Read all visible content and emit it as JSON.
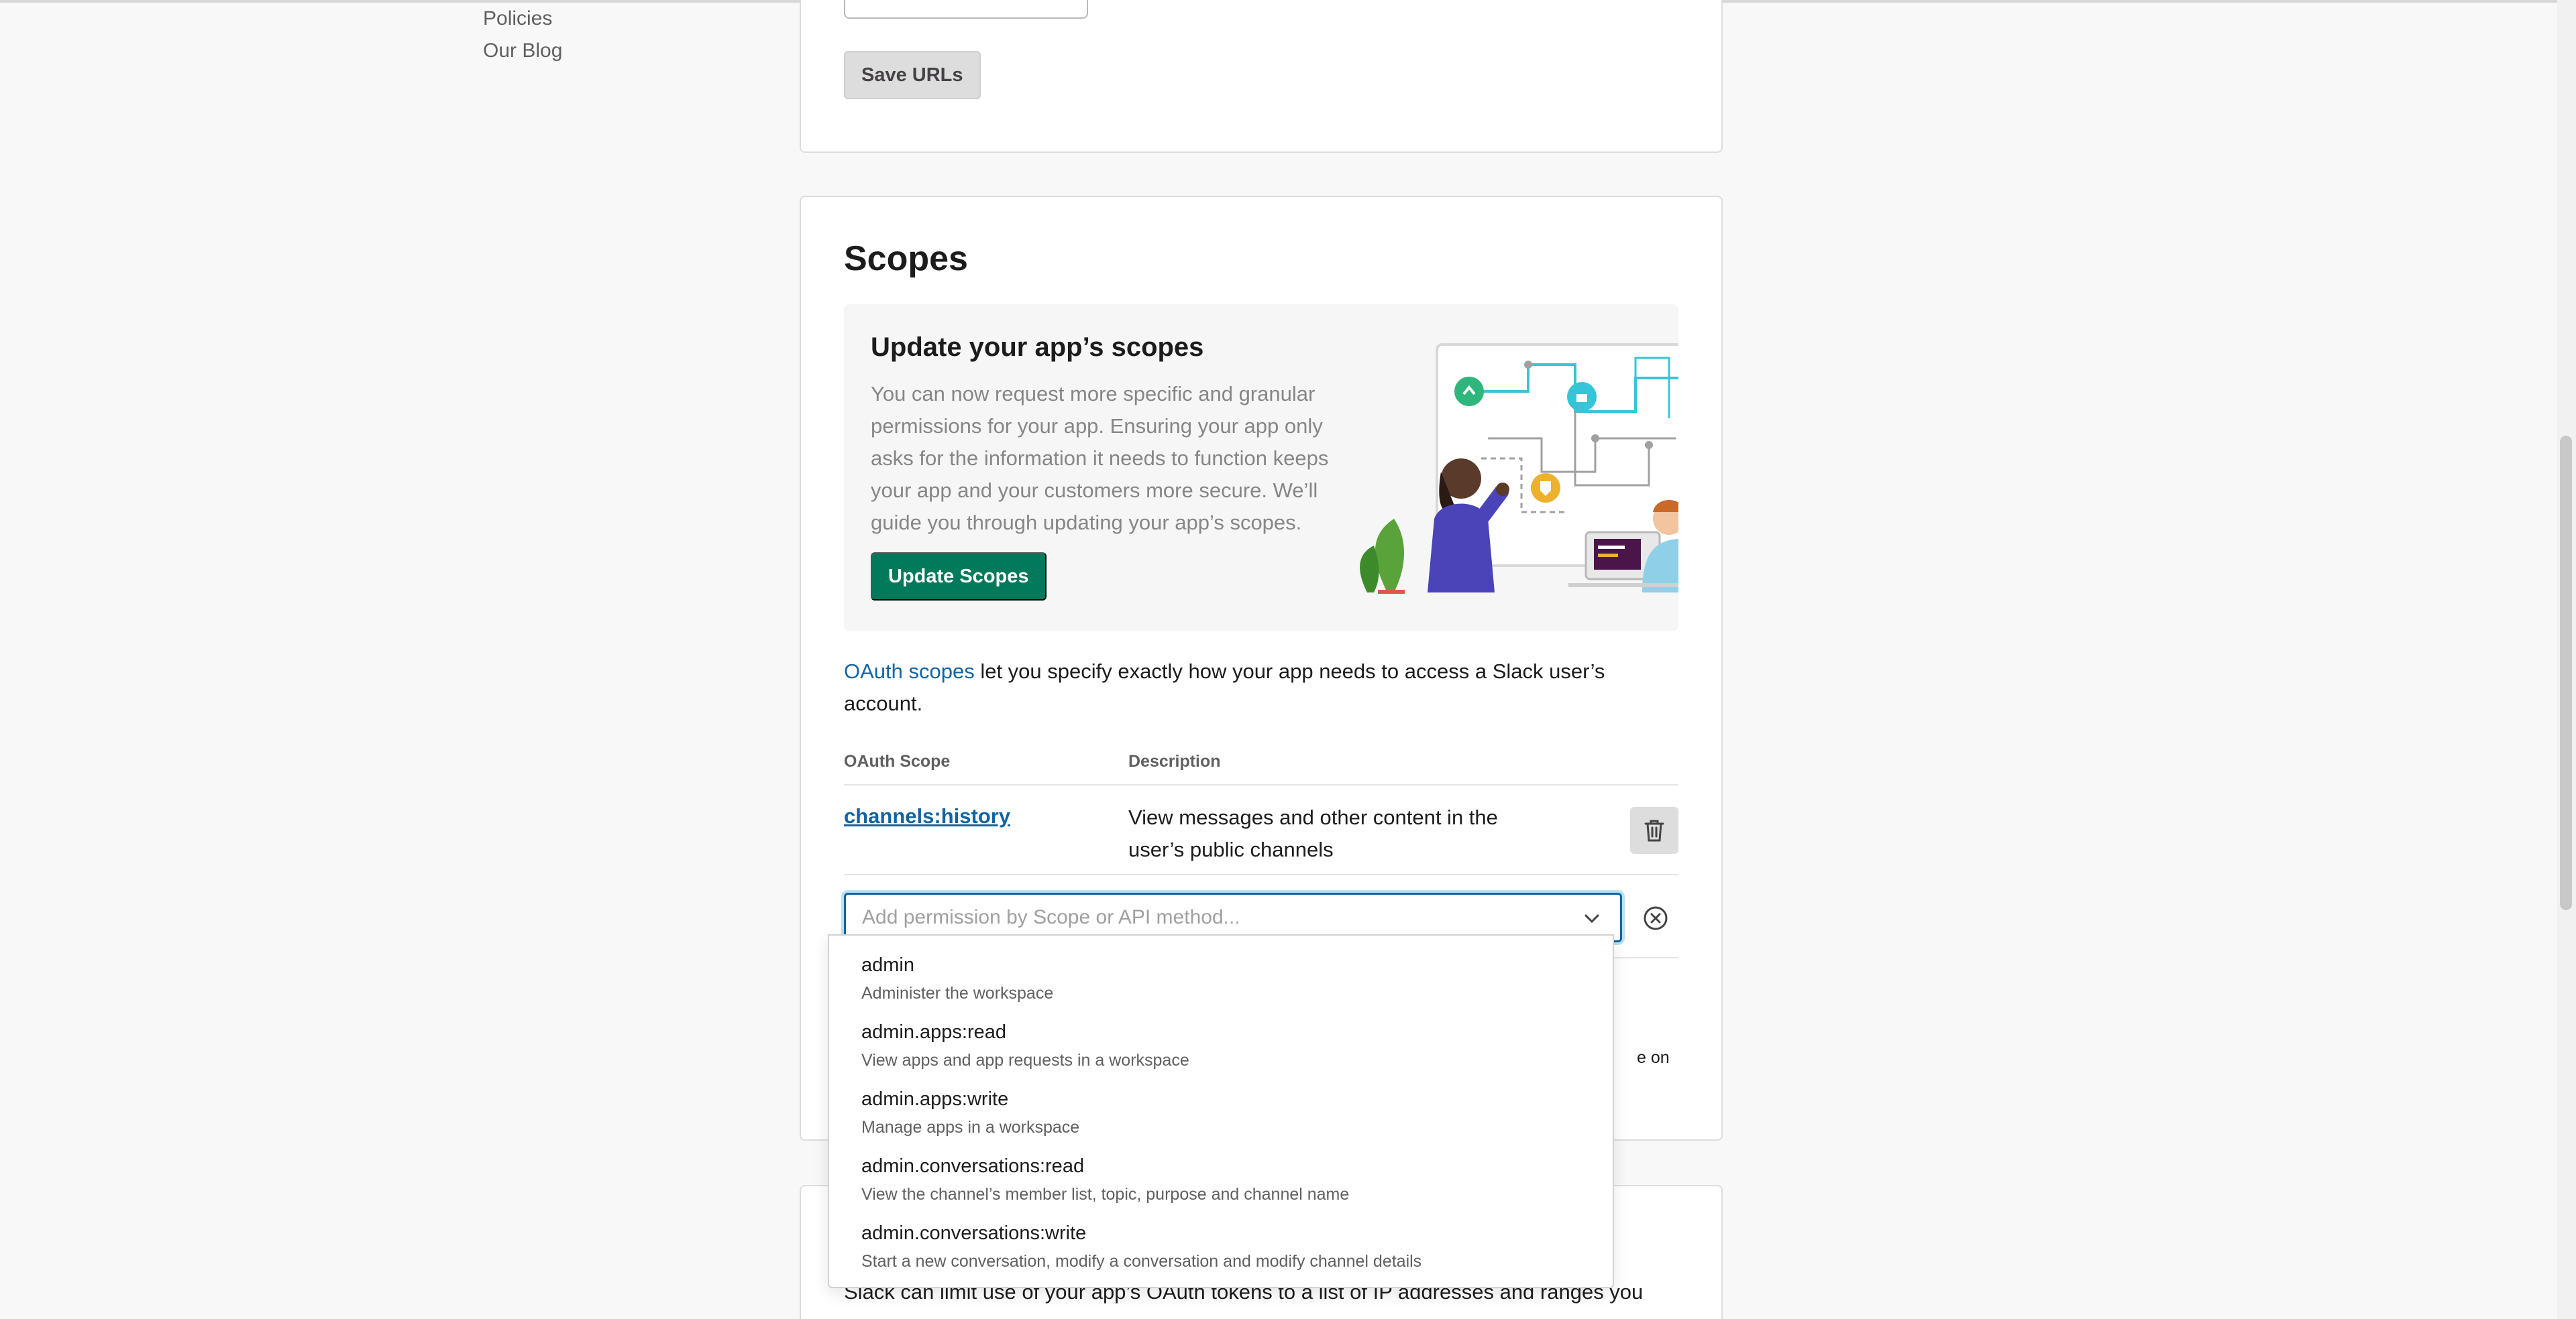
{
  "left_nav": {
    "items": [
      "Policies",
      "Our Blog"
    ]
  },
  "redirect_urls": {
    "save_label": "Save URLs"
  },
  "scopes": {
    "title": "Scopes",
    "promo": {
      "title": "Update your app’s scopes",
      "body": "You can now request more specific and granular permissions for your app. Ensuring your app only asks for the information it needs to function keeps your app and your customers more secure. We’ll guide you through updating your app’s scopes.",
      "button_label": "Update Scopes"
    },
    "oauth_link": "OAuth scopes",
    "oauth_text": " let you specify exactly how your app needs to access a Slack user’s account.",
    "table": {
      "col_scope": "OAuth Scope",
      "col_description": "Description",
      "rows": [
        {
          "scope": "channels:history",
          "description": "View messages and other content in the user’s public channels"
        }
      ]
    },
    "permission_input": {
      "placeholder": "Add permission by Scope or API method...",
      "value": ""
    },
    "partially_hidden_text": "e on"
  },
  "ip_restriction": {
    "text": "Slack can limit use of your app’s OAuth tokens to a list of IP addresses and ranges you"
  },
  "dropdown": {
    "options": [
      {
        "name": "admin",
        "description": "Administer the workspace"
      },
      {
        "name": "admin.apps:read",
        "description": "View apps and app requests in a workspace"
      },
      {
        "name": "admin.apps:write",
        "description": "Manage apps in a workspace"
      },
      {
        "name": "admin.conversations:read",
        "description": "View the channel’s member list, topic, purpose and channel name"
      },
      {
        "name": "admin.conversations:write",
        "description": "Start a new conversation, modify a conversation and modify channel details"
      }
    ]
  },
  "colors": {
    "link": "#1264a3",
    "primary_button": "#007a5a",
    "focus_border": "#1264a3",
    "text": "#1d1c1d",
    "muted_text": "#868686"
  },
  "icons": {
    "delete": "trash-icon",
    "clear": "circle-x-icon",
    "expand": "chevron-down-icon"
  }
}
